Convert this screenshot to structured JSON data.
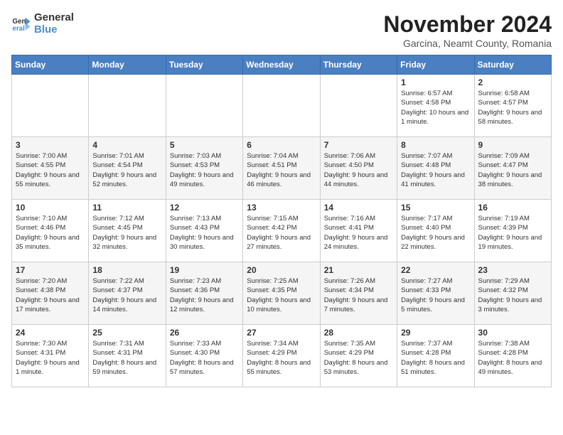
{
  "logo": {
    "line1": "General",
    "line2": "Blue"
  },
  "title": "November 2024",
  "location": "Garcina, Neamt County, Romania",
  "days_of_week": [
    "Sunday",
    "Monday",
    "Tuesday",
    "Wednesday",
    "Thursday",
    "Friday",
    "Saturday"
  ],
  "weeks": [
    [
      {
        "day": "",
        "info": ""
      },
      {
        "day": "",
        "info": ""
      },
      {
        "day": "",
        "info": ""
      },
      {
        "day": "",
        "info": ""
      },
      {
        "day": "",
        "info": ""
      },
      {
        "day": "1",
        "info": "Sunrise: 6:57 AM\nSunset: 4:58 PM\nDaylight: 10 hours and 1 minute."
      },
      {
        "day": "2",
        "info": "Sunrise: 6:58 AM\nSunset: 4:57 PM\nDaylight: 9 hours and 58 minutes."
      }
    ],
    [
      {
        "day": "3",
        "info": "Sunrise: 7:00 AM\nSunset: 4:55 PM\nDaylight: 9 hours and 55 minutes."
      },
      {
        "day": "4",
        "info": "Sunrise: 7:01 AM\nSunset: 4:54 PM\nDaylight: 9 hours and 52 minutes."
      },
      {
        "day": "5",
        "info": "Sunrise: 7:03 AM\nSunset: 4:53 PM\nDaylight: 9 hours and 49 minutes."
      },
      {
        "day": "6",
        "info": "Sunrise: 7:04 AM\nSunset: 4:51 PM\nDaylight: 9 hours and 46 minutes."
      },
      {
        "day": "7",
        "info": "Sunrise: 7:06 AM\nSunset: 4:50 PM\nDaylight: 9 hours and 44 minutes."
      },
      {
        "day": "8",
        "info": "Sunrise: 7:07 AM\nSunset: 4:48 PM\nDaylight: 9 hours and 41 minutes."
      },
      {
        "day": "9",
        "info": "Sunrise: 7:09 AM\nSunset: 4:47 PM\nDaylight: 9 hours and 38 minutes."
      }
    ],
    [
      {
        "day": "10",
        "info": "Sunrise: 7:10 AM\nSunset: 4:46 PM\nDaylight: 9 hours and 35 minutes."
      },
      {
        "day": "11",
        "info": "Sunrise: 7:12 AM\nSunset: 4:45 PM\nDaylight: 9 hours and 32 minutes."
      },
      {
        "day": "12",
        "info": "Sunrise: 7:13 AM\nSunset: 4:43 PM\nDaylight: 9 hours and 30 minutes."
      },
      {
        "day": "13",
        "info": "Sunrise: 7:15 AM\nSunset: 4:42 PM\nDaylight: 9 hours and 27 minutes."
      },
      {
        "day": "14",
        "info": "Sunrise: 7:16 AM\nSunset: 4:41 PM\nDaylight: 9 hours and 24 minutes."
      },
      {
        "day": "15",
        "info": "Sunrise: 7:17 AM\nSunset: 4:40 PM\nDaylight: 9 hours and 22 minutes."
      },
      {
        "day": "16",
        "info": "Sunrise: 7:19 AM\nSunset: 4:39 PM\nDaylight: 9 hours and 19 minutes."
      }
    ],
    [
      {
        "day": "17",
        "info": "Sunrise: 7:20 AM\nSunset: 4:38 PM\nDaylight: 9 hours and 17 minutes."
      },
      {
        "day": "18",
        "info": "Sunrise: 7:22 AM\nSunset: 4:37 PM\nDaylight: 9 hours and 14 minutes."
      },
      {
        "day": "19",
        "info": "Sunrise: 7:23 AM\nSunset: 4:36 PM\nDaylight: 9 hours and 12 minutes."
      },
      {
        "day": "20",
        "info": "Sunrise: 7:25 AM\nSunset: 4:35 PM\nDaylight: 9 hours and 10 minutes."
      },
      {
        "day": "21",
        "info": "Sunrise: 7:26 AM\nSunset: 4:34 PM\nDaylight: 9 hours and 7 minutes."
      },
      {
        "day": "22",
        "info": "Sunrise: 7:27 AM\nSunset: 4:33 PM\nDaylight: 9 hours and 5 minutes."
      },
      {
        "day": "23",
        "info": "Sunrise: 7:29 AM\nSunset: 4:32 PM\nDaylight: 9 hours and 3 minutes."
      }
    ],
    [
      {
        "day": "24",
        "info": "Sunrise: 7:30 AM\nSunset: 4:31 PM\nDaylight: 9 hours and 1 minute."
      },
      {
        "day": "25",
        "info": "Sunrise: 7:31 AM\nSunset: 4:31 PM\nDaylight: 8 hours and 59 minutes."
      },
      {
        "day": "26",
        "info": "Sunrise: 7:33 AM\nSunset: 4:30 PM\nDaylight: 8 hours and 57 minutes."
      },
      {
        "day": "27",
        "info": "Sunrise: 7:34 AM\nSunset: 4:29 PM\nDaylight: 8 hours and 55 minutes."
      },
      {
        "day": "28",
        "info": "Sunrise: 7:35 AM\nSunset: 4:29 PM\nDaylight: 8 hours and 53 minutes."
      },
      {
        "day": "29",
        "info": "Sunrise: 7:37 AM\nSunset: 4:28 PM\nDaylight: 8 hours and 51 minutes."
      },
      {
        "day": "30",
        "info": "Sunrise: 7:38 AM\nSunset: 4:28 PM\nDaylight: 8 hours and 49 minutes."
      }
    ]
  ]
}
